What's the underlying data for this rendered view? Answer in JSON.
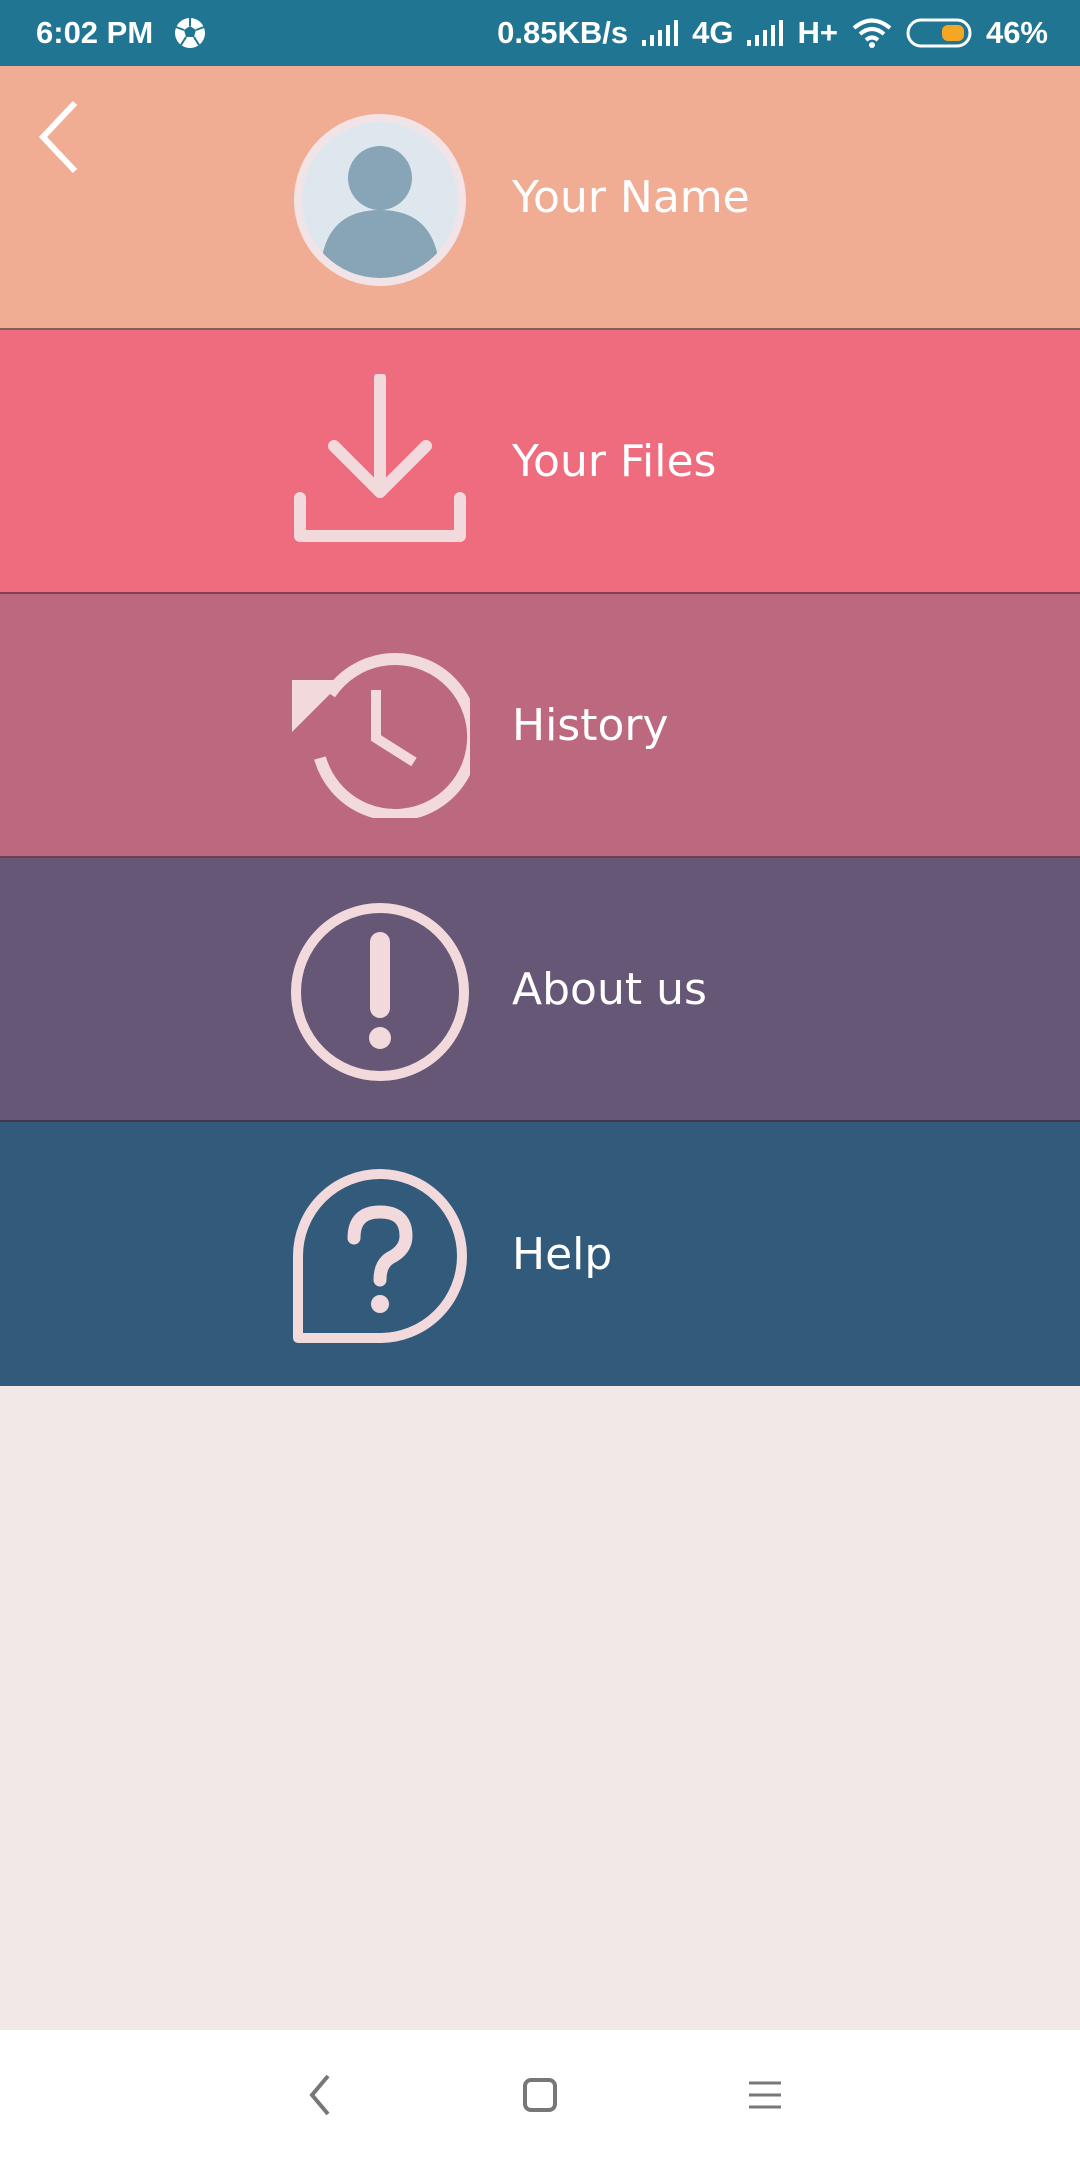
{
  "status_bar": {
    "time": "6:02 PM",
    "network_speed": "0.85KB/s",
    "network_type_1": "4G",
    "network_type_2": "H+",
    "battery": "46%",
    "icons": [
      "soccer-ball-icon",
      "signal-icon",
      "signal-icon",
      "wifi-icon",
      "battery-icon"
    ]
  },
  "menu": {
    "back_icon": "back-arrow-icon",
    "items": [
      {
        "label": "Your Name",
        "icon": "avatar-icon",
        "color": "#f0ad93"
      },
      {
        "label": "Your Files",
        "icon": "download-icon",
        "color": "#ef6c7e"
      },
      {
        "label": "History",
        "icon": "history-icon",
        "color": "#bc687e"
      },
      {
        "label": "About us",
        "icon": "info-exclamation-icon",
        "color": "#675777"
      },
      {
        "label": "Help",
        "icon": "help-bubble-icon",
        "color": "#325a7a"
      }
    ]
  },
  "nav_bar": {
    "icons": [
      "nav-back-icon",
      "nav-home-icon",
      "nav-menu-icon"
    ]
  },
  "colors": {
    "status_bar": "#1f7592",
    "icon_tint": "#f2d9dc",
    "background": "#f3e8e8",
    "battery_fill": "#f5a623"
  }
}
